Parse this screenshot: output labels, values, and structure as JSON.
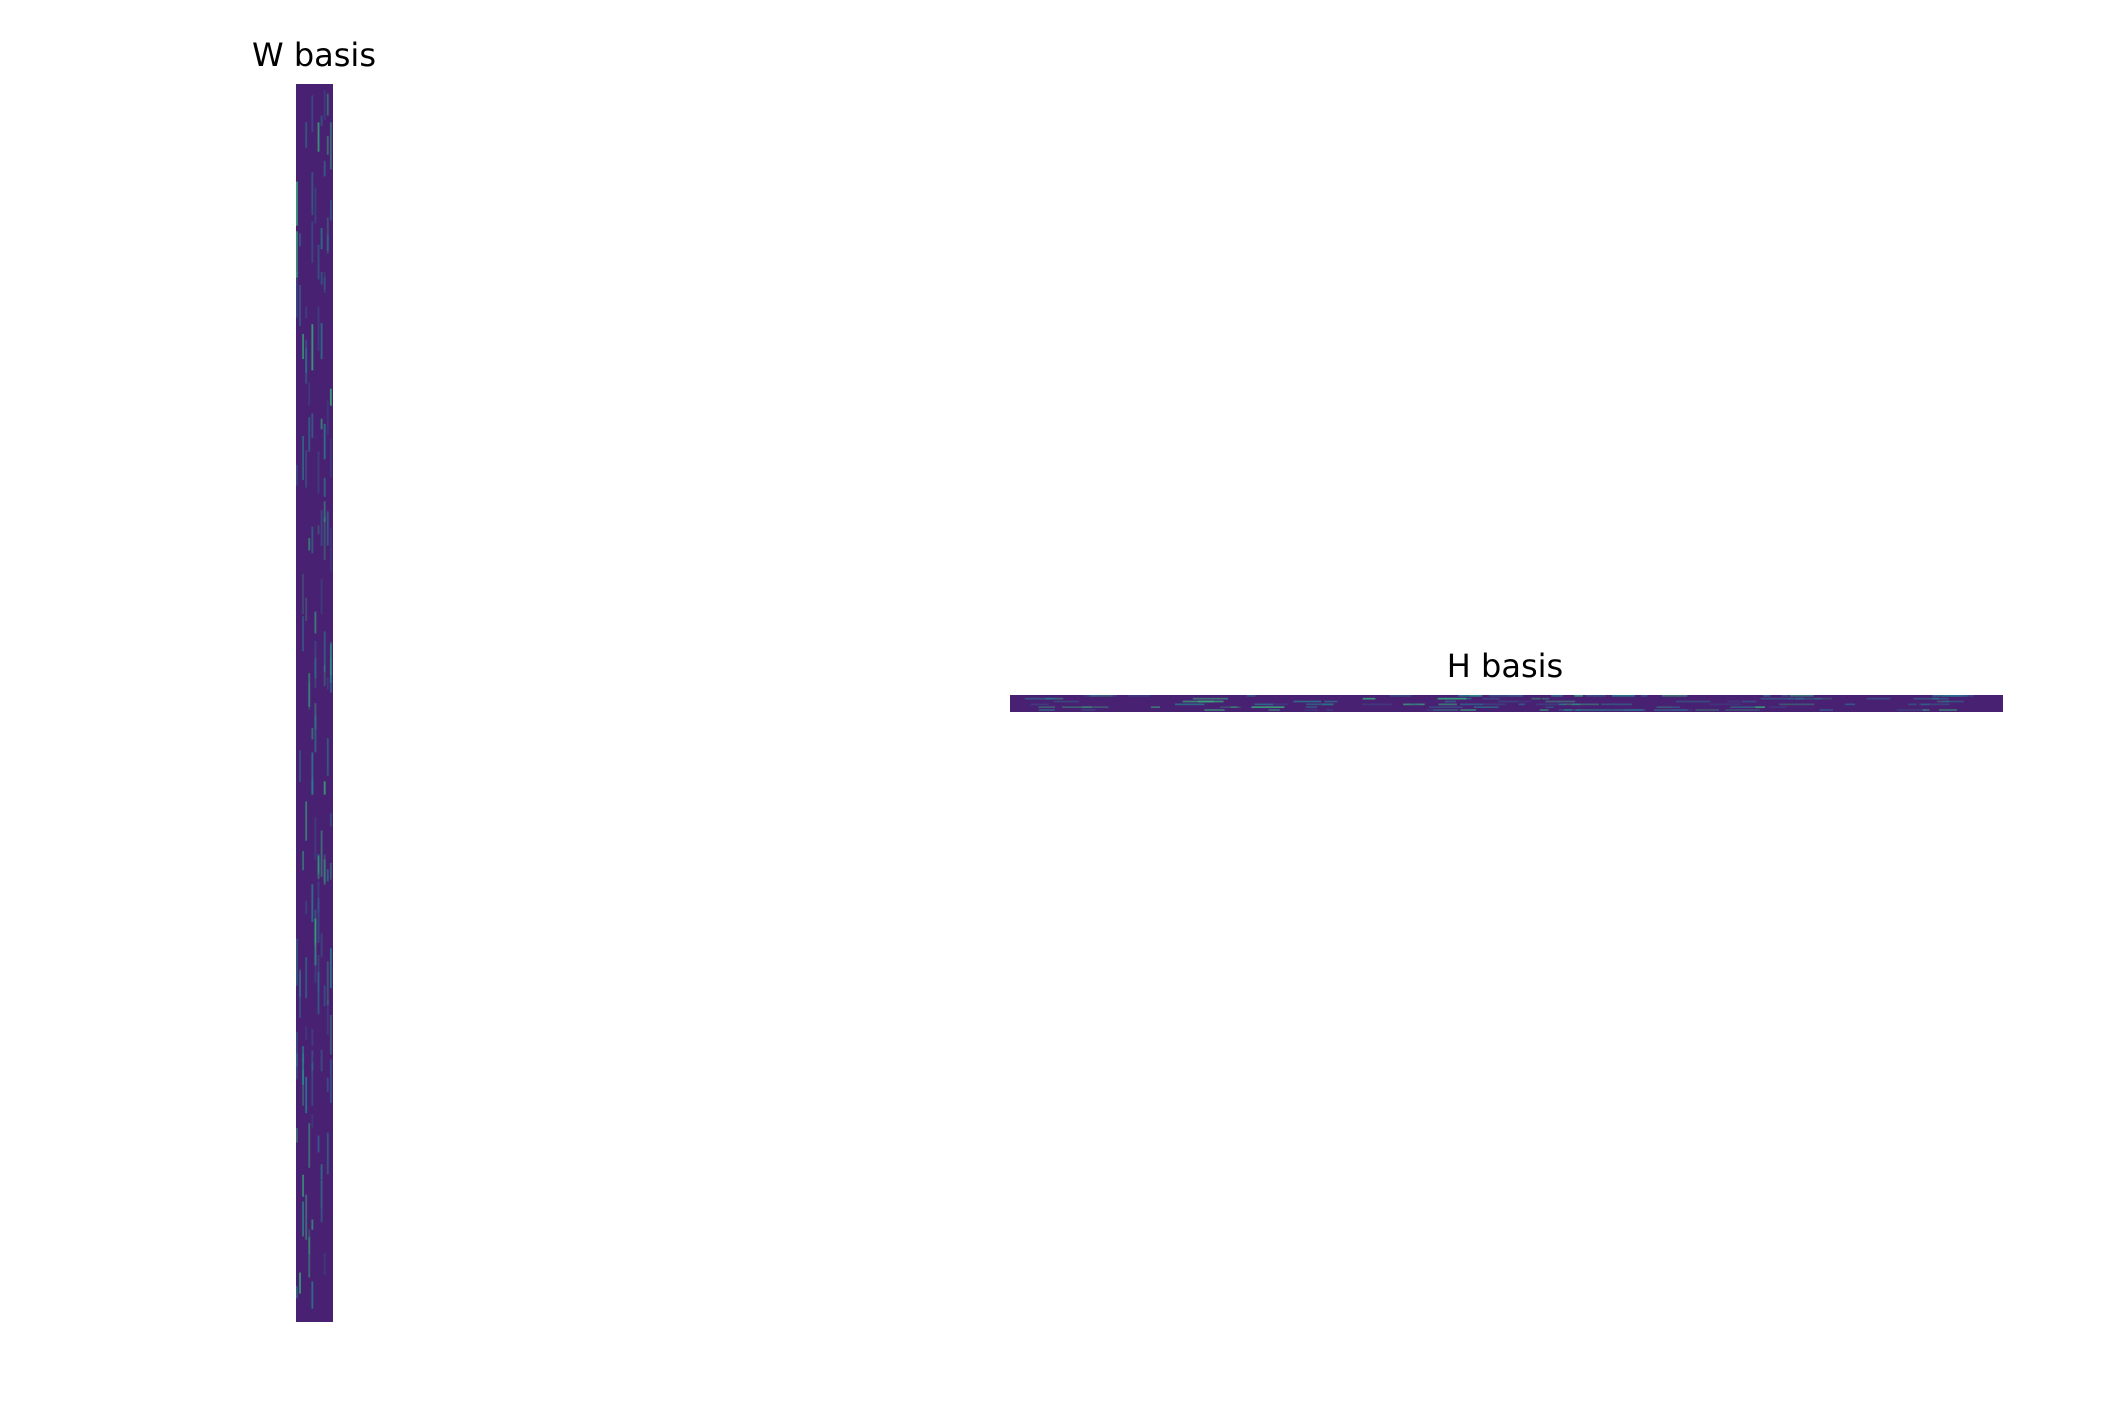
{
  "chart_data": [
    {
      "type": "heatmap",
      "title": "W basis",
      "orientation": "vertical",
      "axes_visible": false,
      "grid": false,
      "colormap": "viridis",
      "base_color": "#482173",
      "highlight_colors": [
        "#31688e",
        "#35b779",
        "#26828e"
      ]
    },
    {
      "type": "heatmap",
      "title": "H basis",
      "orientation": "horizontal",
      "axes_visible": false,
      "grid": false,
      "colormap": "viridis",
      "base_color": "#482173",
      "highlight_colors": [
        "#31688e",
        "#35b779",
        "#26828e"
      ]
    }
  ]
}
